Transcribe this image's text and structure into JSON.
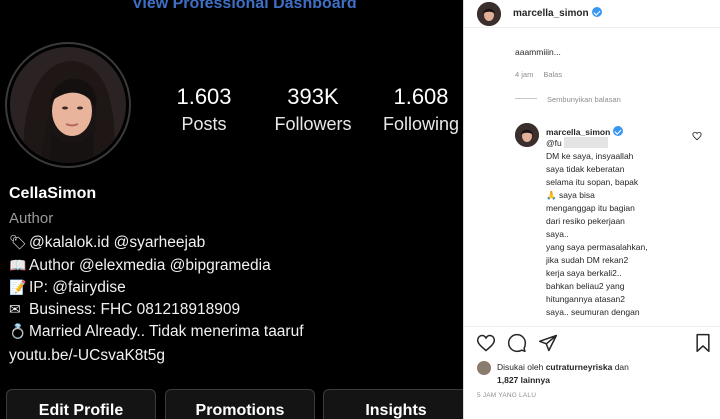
{
  "profile": {
    "dashboard_link": "View Professional Dashboard",
    "stats": [
      {
        "value": "1.603",
        "label": "Posts"
      },
      {
        "value": "393K",
        "label": "Followers"
      },
      {
        "value": "1.608",
        "label": "Following"
      }
    ],
    "name": "CellaSimon",
    "category": "Author",
    "bio": [
      {
        "emoji": "🏷",
        "text": "@kalalok.id @syarheejab"
      },
      {
        "emoji": "📖",
        "text": "Author @elexmedia @bipgramedia"
      },
      {
        "emoji": "📝",
        "text": "IP: @fairydise"
      },
      {
        "emoji": "✉",
        "text": "Business: FHC 081218918909"
      },
      {
        "emoji": "💍",
        "text": "Married Already.. Tidak menerima taaruf"
      },
      {
        "emoji": "",
        "text": "youtu.be/-UCsvaK8t5g"
      }
    ],
    "buttons": [
      "Edit Profile",
      "Promotions",
      "Insights"
    ]
  },
  "post": {
    "header_username": "marcella_simon",
    "previous_comment": {
      "text": "aaammiiin...",
      "time": "4 jam",
      "reply_label": "Balas"
    },
    "hide_replies": "Sembunyikan balasan",
    "reply": {
      "username": "marcella_simon",
      "lines": [
        "@fu            mengirim",
        "DM ke saya, insyaallah",
        "saya tidak keberatan",
        "selama itu sopan, bapak",
        "🙏 saya bisa",
        "menganggap itu bagian",
        "dari resiko pekerjaan",
        "saya..",
        "yang saya permasalahkan,",
        "jika sudah DM rekan2",
        "kerja saya berkali2..",
        "bahkan beliau2 yang",
        "hitungannya atasan2",
        "saya.. seumuran dengan",
        ""
      ]
    },
    "liked_by_prefix": "Disukai oleh",
    "liked_by_user": "cutraturneyriska",
    "liked_by_suffix": "dan",
    "liked_others": "1,827 lainnya",
    "timestamp": "5 JAM YANG LALU"
  },
  "colors": {
    "link_blue": "#3f6fc4",
    "verified_blue": "#3897f0",
    "muted_gray": "#8e8e8e"
  }
}
